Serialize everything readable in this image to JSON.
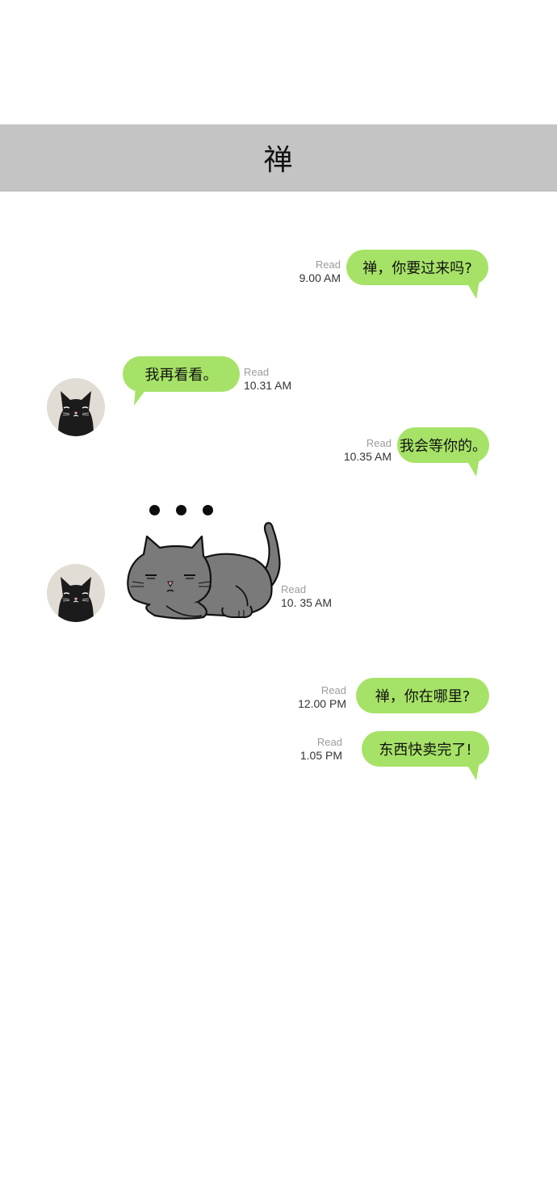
{
  "header": {
    "title": "禅"
  },
  "colors": {
    "header_bg": "#c4c4c4",
    "bubble": "#a6e267",
    "read_text": "#9b9b9b",
    "time_text": "#333333"
  },
  "messages": [
    {
      "side": "outgoing",
      "text": "禅，你要过来吗?",
      "status": "Read",
      "time": "9.00 AM"
    },
    {
      "side": "incoming",
      "text": "我再看看。",
      "status": "Read",
      "time": "10.31 AM"
    },
    {
      "side": "outgoing",
      "text": "我会等你的。",
      "status": "Read",
      "time": "10.35 AM"
    },
    {
      "side": "incoming",
      "sticker": "grumpy-gray-cat-sticker",
      "status": "Read",
      "time": "10. 35 AM"
    },
    {
      "side": "outgoing",
      "text": "禅，你在哪里?",
      "status": "Read",
      "time": "12.00 PM"
    },
    {
      "side": "outgoing",
      "text": "东西快卖完了!",
      "status": "Read",
      "time": "1.05 PM"
    }
  ],
  "icons": {
    "avatar": "black-cat-avatar-icon",
    "typing": "ellipsis-dots-icon",
    "sticker": "grumpy-gray-cat-sticker"
  }
}
